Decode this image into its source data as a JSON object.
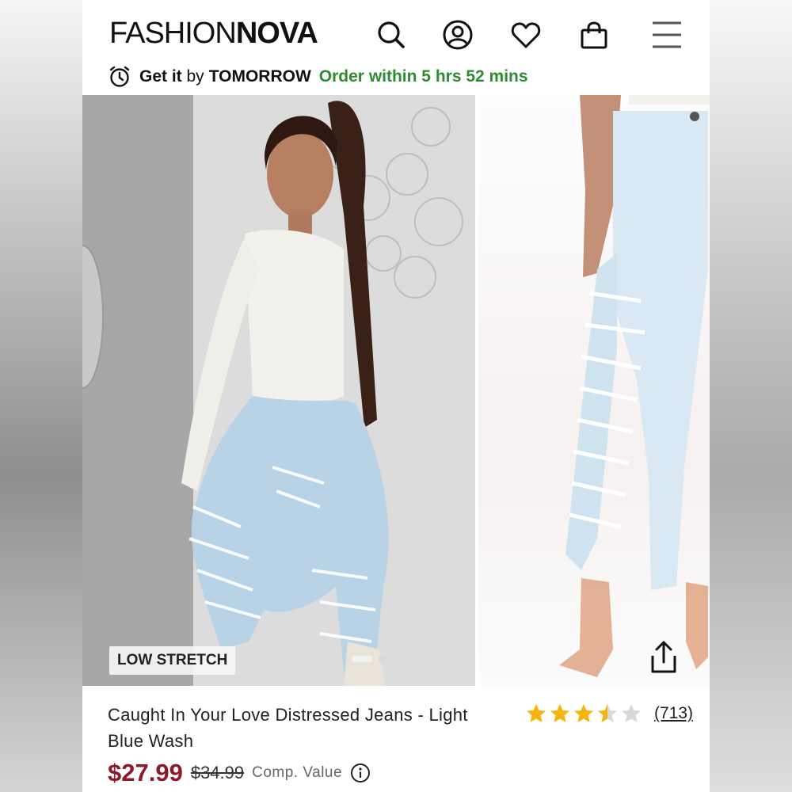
{
  "header": {
    "logo_thin": "FASHION",
    "logo_bold": "NOVA",
    "icons": [
      "search-icon",
      "account-icon",
      "wishlist-heart-icon",
      "shopping-bag-icon",
      "menu-icon"
    ]
  },
  "delivery": {
    "prefix_bold": "Get it",
    "prefix_light": " by",
    "when": "TOMORROW",
    "cutoff": "Order within 5 hrs 52 mins",
    "icon": "alarm-clock-icon"
  },
  "gallery": {
    "badge": "LOW STRETCH",
    "slide_count": 3,
    "active_slide": 1,
    "share_icon": "share-icon"
  },
  "product": {
    "title": "Caught In Your Love Distressed Jeans - Light Blue Wash",
    "rating": 3.5,
    "rating_max": 5,
    "review_count": "(713)",
    "price": "$27.99",
    "compare_price": "$34.99",
    "compare_label": "Comp. Value",
    "info_icon": "info-icon"
  },
  "colors": {
    "price": "#8b1a2b",
    "cutoff_green": "#2e8b2e",
    "star_gold": "#f5b50a",
    "star_empty": "#d9d9d9"
  }
}
